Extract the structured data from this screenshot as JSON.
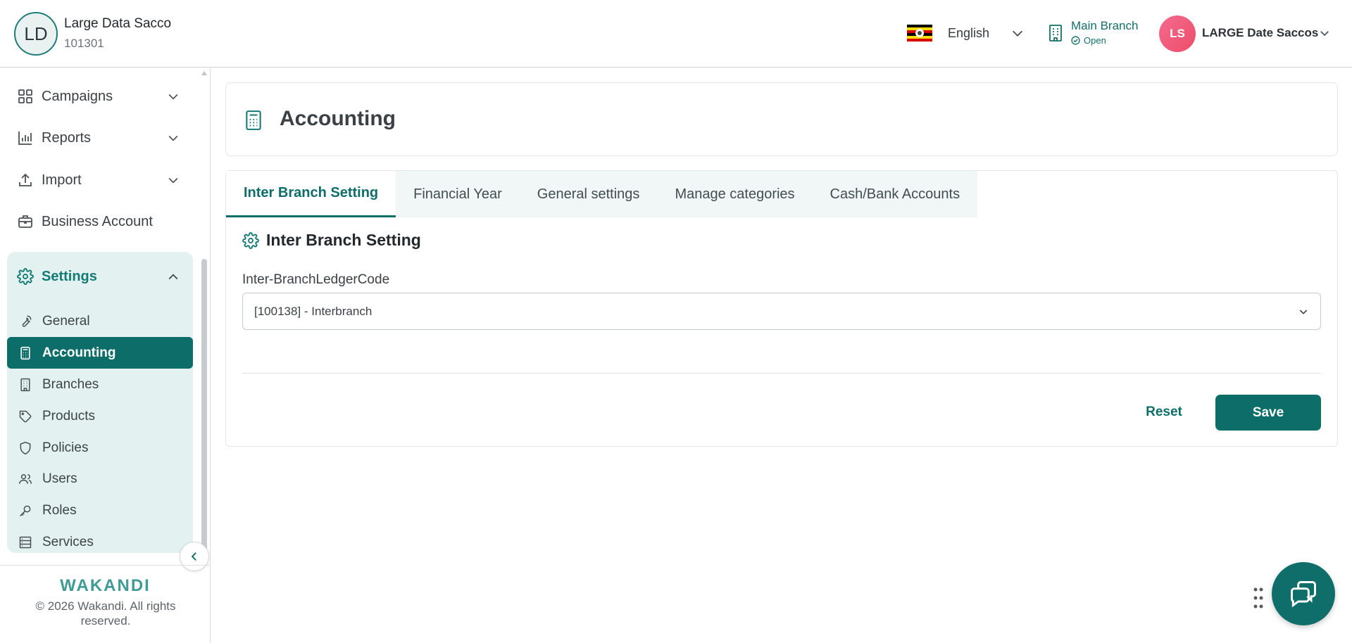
{
  "org": {
    "initials": "LD",
    "name": "Large Data Sacco",
    "code": "101301"
  },
  "header": {
    "language": "English",
    "branch_name": "Main Branch",
    "branch_status": "Open",
    "user_initials": "LS",
    "user_name": "LARGE Date Saccos"
  },
  "sidebar": {
    "items": [
      {
        "label": "Campaigns"
      },
      {
        "label": "Reports"
      },
      {
        "label": "Import"
      },
      {
        "label": "Business Account"
      }
    ],
    "settings_label": "Settings",
    "settings_items": [
      {
        "label": "General"
      },
      {
        "label": "Accounting"
      },
      {
        "label": "Branches"
      },
      {
        "label": "Products"
      },
      {
        "label": "Policies"
      },
      {
        "label": "Users"
      },
      {
        "label": "Roles"
      },
      {
        "label": "Services"
      }
    ],
    "brand": "WAKANDI",
    "copyright": "© 2026 Wakandi. All rights reserved."
  },
  "page": {
    "title": "Accounting"
  },
  "tabs": [
    {
      "label": "Inter Branch Setting"
    },
    {
      "label": "Financial Year"
    },
    {
      "label": "General settings"
    },
    {
      "label": "Manage categories"
    },
    {
      "label": "Cash/Bank Accounts"
    }
  ],
  "form": {
    "section_title": "Inter Branch Setting",
    "field_label": "Inter-BranchLedgerCode",
    "field_value": "[100138] - Interbranch",
    "reset_label": "Reset",
    "save_label": "Save"
  },
  "colors": {
    "accent": "#0d6e69",
    "accent_light": "#e3f1f0",
    "avatar": "#ee4d6a"
  }
}
